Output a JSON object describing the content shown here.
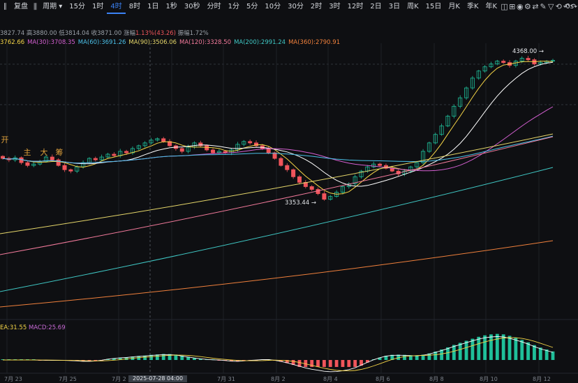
{
  "toolbar": {
    "left_prefix": "∥",
    "restore": "复盘",
    "chart_style_icon": "candles-icon",
    "period_label": "周期",
    "periods": [
      "15分",
      "1时",
      "4时",
      "8时",
      "1日",
      "1秒",
      "30秒",
      "分时",
      "1分",
      "5分",
      "10分",
      "30分",
      "2时",
      "3时",
      "12时",
      "2日",
      "3日",
      "周K",
      "15日",
      "月K",
      "季K",
      "年K"
    ],
    "active_period": "4时",
    "right_text": "0s"
  },
  "side_buttons": [
    "开",
    "主",
    "大",
    "筹"
  ],
  "ohlc": {
    "open": "3827.74",
    "high_label": "高",
    "high": "3880.00",
    "low_label": "低",
    "low": "3814.04",
    "close_label": "收",
    "close": "3871.00",
    "change_label": "涨幅",
    "change": "1.13%(43.26)",
    "amp_label": "振幅",
    "amp": "1.72%"
  },
  "ma_legend": [
    {
      "text": "3762.66",
      "color": "#f5d547"
    },
    {
      "text": "MA(30):3708.35",
      "color": "#d35fd0"
    },
    {
      "text": "MA(60):3691.26",
      "color": "#4bc0e8"
    },
    {
      "text": "MA(90):3506.06",
      "color": "#e6d76a"
    },
    {
      "text": "MA(120):3328.50",
      "color": "#f27a9b"
    },
    {
      "text": "MA(200):2991.24",
      "color": "#3fc7c4"
    },
    {
      "text": "MA(360):2790.91",
      "color": "#f0803c"
    }
  ],
  "annotations": {
    "high_price": "4368.00",
    "low_price": "3353.44"
  },
  "macd": {
    "dea": "EA:31.55",
    "macd": "MACD:25.69",
    "dea_color": "#f5d547",
    "macd_color": "#c86ad6"
  },
  "xaxis": [
    "7月 23",
    "7月 25",
    "7月 2",
    "29",
    "7月 31",
    "8月 2",
    "8月 4",
    "8月 6",
    "8月 8",
    "8月 10",
    "8月 12"
  ],
  "crosshair_time": "2025-07-28 04:00",
  "colors": {
    "up": "#1fbf9a",
    "down": "#f0555b",
    "grid": "#1d2026",
    "accent": "#3b82f6"
  },
  "chart_data": {
    "type": "candlestick",
    "title": "",
    "candles_close": [
      3650,
      3640,
      3655,
      3620,
      3600,
      3610,
      3630,
      3660,
      3640,
      3600,
      3570,
      3560,
      3590,
      3620,
      3650,
      3640,
      3660,
      3680,
      3670,
      3700,
      3690,
      3720,
      3740,
      3760,
      3780,
      3790,
      3770,
      3740,
      3720,
      3700,
      3730,
      3760,
      3740,
      3710,
      3690,
      3700,
      3690,
      3710,
      3750,
      3770,
      3760,
      3740,
      3720,
      3690,
      3650,
      3600,
      3570,
      3520,
      3480,
      3450,
      3430,
      3400,
      3360,
      3380,
      3410,
      3450,
      3470,
      3520,
      3560,
      3590,
      3610,
      3600,
      3580,
      3560,
      3540,
      3560,
      3590,
      3620,
      3700,
      3760,
      3820,
      3880,
      3950,
      4020,
      4080,
      4150,
      4220,
      4270,
      4300,
      4320,
      4340,
      4330,
      4310,
      4340,
      4360,
      4350,
      4320,
      4330,
      4340,
      4345
    ],
    "ma_series": [
      "MA5",
      "MA30",
      "MA60",
      "MA90",
      "MA120",
      "MA200",
      "MA360"
    ],
    "annotated_high": 4368.0,
    "annotated_low": 3353.44
  }
}
